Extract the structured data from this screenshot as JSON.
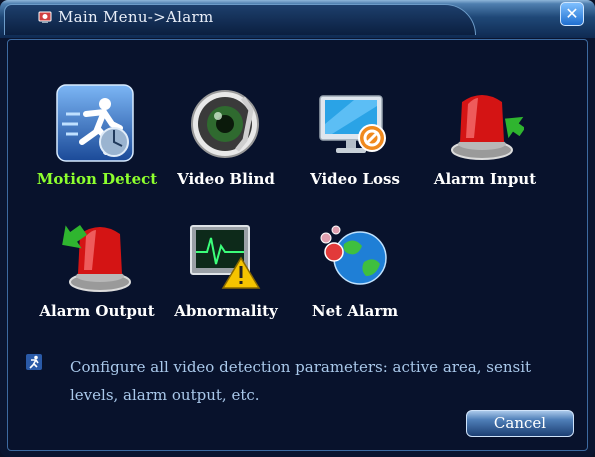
{
  "window": {
    "title": "Main Menu->Alarm",
    "close_label": "✕"
  },
  "menu": {
    "items": [
      {
        "label": "Motion Detect",
        "icon": "motion-detect-icon",
        "selected": true
      },
      {
        "label": "Video Blind",
        "icon": "video-blind-icon",
        "selected": false
      },
      {
        "label": "Video Loss",
        "icon": "video-loss-icon",
        "selected": false
      },
      {
        "label": "Alarm Input",
        "icon": "alarm-input-icon",
        "selected": false
      },
      {
        "label": "Alarm Output",
        "icon": "alarm-output-icon",
        "selected": false
      },
      {
        "label": "Abnormality",
        "icon": "abnormality-icon",
        "selected": false
      },
      {
        "label": "Net Alarm",
        "icon": "net-alarm-icon",
        "selected": false
      }
    ]
  },
  "help": {
    "text_line1": "Configure all video detection parameters: active area, sensit",
    "text_line2": "levels, alarm output, etc."
  },
  "footer": {
    "cancel_label": "Cancel"
  },
  "colors": {
    "selected_label": "#8dff2e",
    "label": "#ffffff",
    "help_text": "#a9c8ea",
    "background": "#08122c"
  }
}
